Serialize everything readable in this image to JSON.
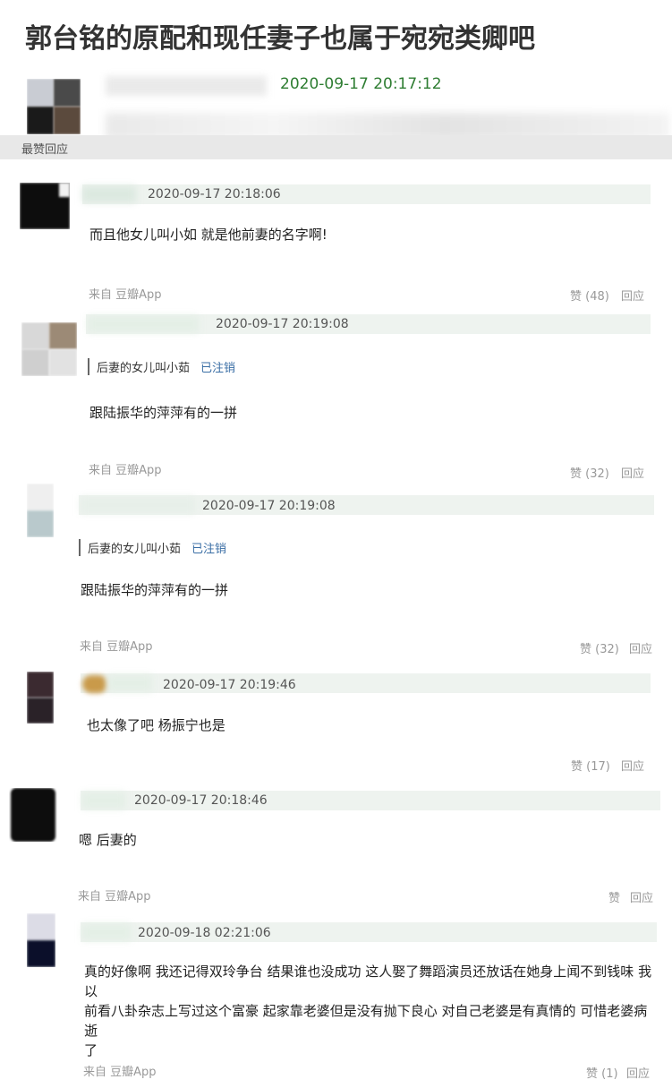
{
  "title": "郭台铭的原配和现任妻子也属于宛宛类卿吧",
  "post": {
    "time": "2020-09-17 20:17:12"
  },
  "section_label": "最赞回应",
  "comments": [
    {
      "time": "2020-09-17 20:18:06",
      "text": "而且他女儿叫小如 就是他前妻的名字啊!",
      "source": "来自 豆瓣App",
      "like": "赞 (48)",
      "reply": "回应"
    },
    {
      "time": "2020-09-17 20:19:08",
      "quote_author": "后妻的女儿叫小茹",
      "quote_status": "已注销",
      "text": "跟陆振华的萍萍有的一拼",
      "source": "来自 豆瓣App",
      "like": "赞 (32)",
      "reply": "回应"
    },
    {
      "time": "2020-09-17 20:19:08",
      "quote_author": "后妻的女儿叫小茹",
      "quote_status": "已注销",
      "text": "跟陆振华的萍萍有的一拼",
      "source": "来自 豆瓣App",
      "like": "赞 (32)",
      "reply": "回应"
    },
    {
      "time": "2020-09-17 20:19:46",
      "text": "也太像了吧 杨振宁也是",
      "like": "赞 (17)",
      "reply": "回应"
    },
    {
      "time": "2020-09-17 20:18:46",
      "text": "嗯 后妻的",
      "source": "来自 豆瓣App",
      "like": "赞",
      "reply": "回应"
    },
    {
      "time": "2020-09-18 02:21:06",
      "text_lines": [
        "真的好像啊 我还记得双玲争台 结果谁也没成功 这人娶了舞蹈演员还放话在她身上闻不到钱味 我以",
        "前看八卦杂志上写过这个富豪 起家靠老婆但是没有抛下良心 对自己老婆是有真情的 可惜老婆病逝",
        "了"
      ],
      "source": "来自 豆瓣App",
      "like": "赞 (1)",
      "reply": "回应"
    }
  ]
}
